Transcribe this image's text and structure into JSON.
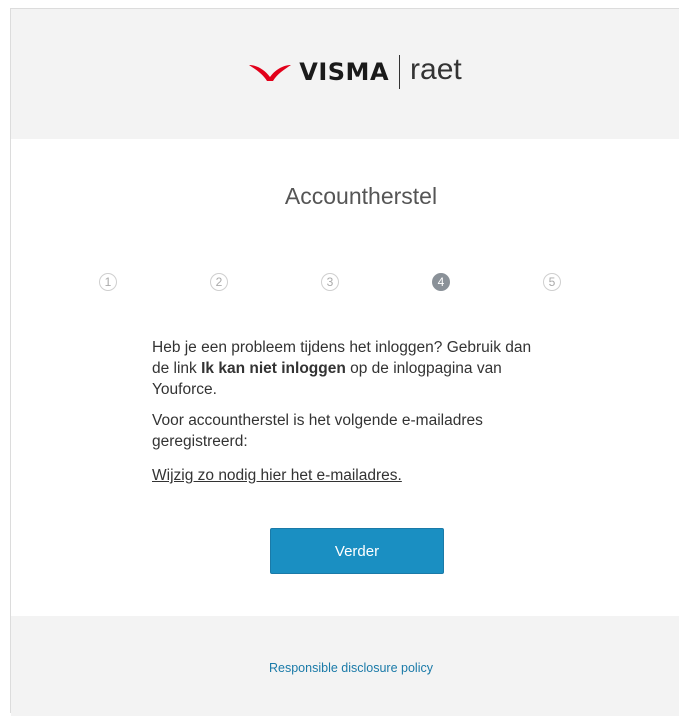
{
  "header": {
    "logo_visma": "VISMA",
    "logo_raet": "raet",
    "brand_color": "#e2001a"
  },
  "main": {
    "title": "Accountherstel",
    "steps": [
      {
        "label": "1",
        "active": false
      },
      {
        "label": "2",
        "active": false
      },
      {
        "label": "3",
        "active": false
      },
      {
        "label": "4",
        "active": true
      },
      {
        "label": "5",
        "active": false
      }
    ],
    "paragraph1_part1": "Heb je een probleem tijdens het inloggen? Gebruik dan de link ",
    "paragraph1_bold": "Ik kan niet inloggen",
    "paragraph1_part2": " op de inlogpagina van Youforce.",
    "paragraph2": "Voor accountherstel is het volgende e-mailadres geregistreerd:",
    "change_link": "Wijzig zo nodig hier het e-mailadres.",
    "next_button": "Verder",
    "button_color": "#1a8fc2"
  },
  "footer": {
    "link": "Responsible disclosure policy"
  }
}
